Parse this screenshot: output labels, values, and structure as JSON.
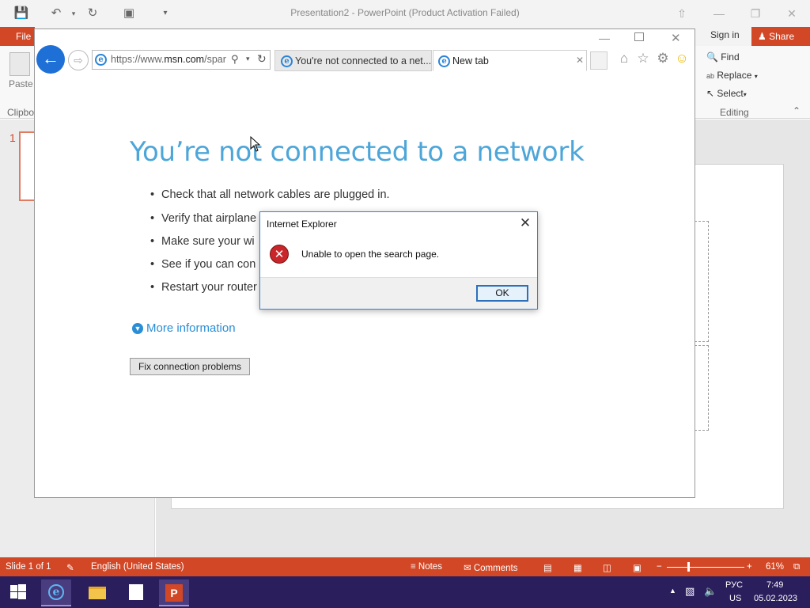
{
  "powerpoint": {
    "title": "Presentation2 - PowerPoint (Product Activation Failed)",
    "file_tab": "File",
    "sign_in": "Sign in",
    "share": "Share",
    "paste_label": "Paste",
    "clipboard_group": "Clipbo",
    "editing": {
      "find": "Find",
      "replace": "Replace",
      "select": "Select",
      "group_label": "Editing"
    },
    "slide_number": "1",
    "status": {
      "slide": "Slide 1 of 1",
      "language": "English (United States)",
      "notes": "Notes",
      "comments": "Comments",
      "zoom": "61%"
    }
  },
  "ie": {
    "address": "https://www.msn.com/spar",
    "address_prefix": "https://www.",
    "address_domain": "msn.com",
    "address_rest": "/spar",
    "tabs": [
      {
        "label": "You're not connected to a net...",
        "active": false
      },
      {
        "label": "New tab",
        "active": true
      }
    ],
    "page": {
      "heading": "You’re not connected to a network",
      "bullets": [
        "Check that all network cables are plugged in.",
        "Verify that airplane",
        "Make sure your wi",
        "See if you can con",
        "Restart your router"
      ],
      "more_info": "More information",
      "fix_button": "Fix connection problems"
    }
  },
  "dialog": {
    "title": "Internet Explorer",
    "message": "Unable to open the search page.",
    "ok": "OK",
    "icon": "error-icon"
  },
  "taskbar": {
    "lang": "РУС",
    "layout": "US",
    "time": "7:49",
    "date": "05.02.2023"
  },
  "colors": {
    "ppt_accent": "#d24726",
    "ie_blue": "#1e6fd6",
    "heading_blue": "#4da6d9",
    "taskbar": "#2b1e5c"
  }
}
